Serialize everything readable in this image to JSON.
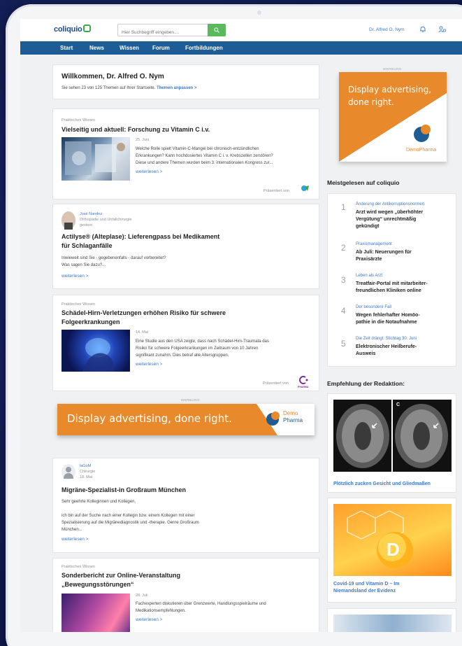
{
  "header": {
    "logo": "coliquio",
    "search_placeholder": "Hier Suchbegriff eingeben....",
    "user_name": "Dr. Alfred O. Nym"
  },
  "nav": [
    "Start",
    "News",
    "Wissen",
    "Forum",
    "Fortbildungen"
  ],
  "welcome": {
    "title": "Willkommen, Dr. Alfred O. Nym",
    "subtitle": "Sie sehen 23 von 125 Themen auf Ihrer Startseite.",
    "link": "Themen anpassen >"
  },
  "feed": [
    {
      "kicker": "Praktisches Wissen",
      "title": "Vielseitig und aktuell: Forschung zu Vitamin C i.v.",
      "date": "25. Juni",
      "text": [
        "Welche Rolle spielt Vitamin-C-Mangel bei chronisch-entzündlichen",
        "Erkrankungen? Kann hochdosiertes Vitamin C i. v. Krebszellen zerstören?",
        "Diese und andere Themen wurden beim 3. internationalen Kongress zur..."
      ],
      "more": "weiterlesen >",
      "presented": "Präsentiert von"
    },
    {
      "author": "José Nandez",
      "role": "Orthopädie und Unfallchirurgie",
      "time": "gestern",
      "title": [
        "Actilyse® (Alteplase): Lieferengpass bei Medikament",
        "für Schlaganfälle"
      ],
      "text": [
        "Inwieweit sind Sie - gegebenenfalls - darauf vorbereitet?",
        "Was sagen Sie dazu?..."
      ],
      "more": "weiterlesen >"
    },
    {
      "kicker": "Praktisches Wissen",
      "title": [
        "Schädel-Hirn-Verletzungen erhöhen Risiko für schwere",
        "Folgeerkrankungen"
      ],
      "date": "14. Mai",
      "text": [
        "Eine Studie aus den USA zeigte, dass nach Schädel-Hirn-Traumata das",
        "Risiko für schwere Folgeerkrankungen im Zeitraum von 10 Jahren",
        "signifikant zunahm. Dies betraf alle Altersgruppen."
      ],
      "more": "weiterlesen >",
      "presented": "Präsentiert von"
    },
    {
      "author": "laGoM",
      "role": "Chirurgie",
      "time": "18. Mai",
      "title": "Migräne-Spezialist-in Großraum München",
      "text": [
        "Sehr geehrte Kolleginnen und Kollegen,",
        "",
        "ich bin auf der Suche nach einer Kollegin bzw. einem Kollegen mit einer",
        "Spezialisierung auf die Migränediagnostik und -therapie. Gerne Großraum",
        "München..."
      ],
      "more": "weiterlesen >"
    },
    {
      "kicker": "Praktisches Wissen",
      "title": [
        "Sonderbericht zur Online-Veranstaltung",
        "„Bewegungsstörungen“"
      ],
      "date": "28. Juli",
      "text": [
        "Fachexperten diskutieren über Grenzwerte, Handlungsspielräume und",
        "Medikationsempfehlungen."
      ],
      "more": "weiterlesen >"
    }
  ],
  "ads": {
    "label": "WERBUNG",
    "box_text": [
      "Display advertising,",
      "done right."
    ],
    "banner_text": "Display advertising, done right.",
    "brand": "DemoPharma",
    "brand_line1": "Demo",
    "brand_line2": "Pharma",
    "mini_brand": "PHARMA",
    "color_orange": "#e8892b",
    "color_blue": "#1d5c95"
  },
  "most_read": {
    "heading": "Meistgelesen auf coliquio",
    "items": [
      {
        "num": "1",
        "cat": "Änderung der Antikorruptionsnormen",
        "title": [
          "Arzt wird wegen „überhöhter",
          "Vergütung“ unrechtmäßig",
          "gekündigt"
        ]
      },
      {
        "num": "2",
        "cat": "Praxismanagement",
        "title": [
          "Ab Juli: Neuerungen für",
          "Praxisärzte"
        ]
      },
      {
        "num": "3",
        "cat": "Leben als Arzt",
        "title": [
          "Treatfair-Portal mit mitarbeiter-",
          "freundlichen Kliniken online"
        ]
      },
      {
        "num": "4",
        "cat": "Der besondere Fall",
        "title": [
          "Wegen fehlerhafter Homöo-",
          "pathie in die Notaufnahme"
        ]
      },
      {
        "num": "5",
        "cat": "Die Zeit drängt: Stichtag 30. Juni",
        "title": [
          "Elektronischer Heilberufe-",
          "Ausweis"
        ]
      }
    ]
  },
  "recommendations": {
    "heading": "Empfehlung der Redaktion:",
    "items": [
      {
        "title": "Plötzlich zucken Gesicht und Gliedmaßen",
        "scan_label": "C"
      },
      {
        "title": [
          "Covid-19 und Vitamin D – Im",
          "Niemandsland der Evidenz"
        ],
        "badge": "D"
      }
    ]
  }
}
